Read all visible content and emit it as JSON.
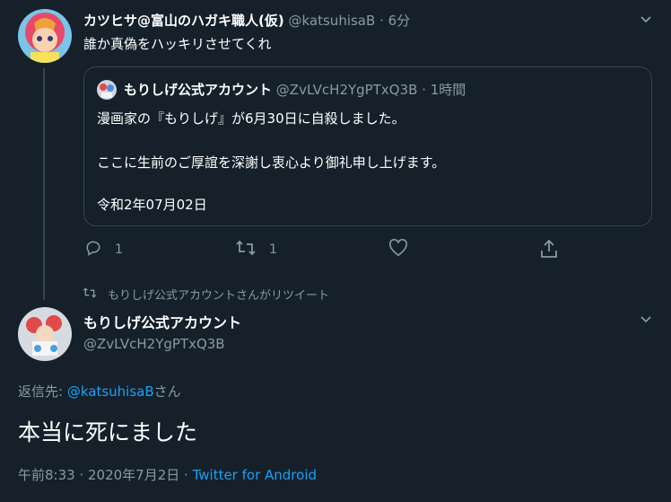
{
  "tweet1": {
    "display_name": "カツヒサ@富山のハガキ職人(仮)",
    "handle": "@katsuhisaB",
    "time": "· 6分",
    "text": "誰か真偽をハッキリさせてくれ",
    "quote": {
      "display_name": "もりしげ公式アカウント",
      "handle": "@ZvLVcH2YgPTxQ3B",
      "time": "· 1時間",
      "line1": "漫画家の『もりしげ』が6月30日に自殺しました。",
      "line2": "ここに生前のご厚誼を深謝し衷心より御礼申し上げます。",
      "line3": "令和2年07月02日"
    },
    "actions": {
      "reply_count": "1",
      "retweet_count": "1"
    }
  },
  "retweet_notice": "もりしげ公式アカウントさんがリツイート",
  "tweet2": {
    "display_name": "もりしげ公式アカウント",
    "handle": "@ZvLVcH2YgPTxQ3B",
    "reply_to_label": "返信先:",
    "reply_to_handle": "@katsuhisaB",
    "reply_to_suffix": "さん",
    "text": "本当に死にました",
    "timestamp": "午前8:33 · 2020年7月2日 ·",
    "source": "Twitter for Android"
  },
  "colors": {
    "background": "#15202b",
    "border": "#38444d",
    "muted": "#8899a6",
    "accent": "#1da1f2"
  },
  "icons": [
    "chevron-down-icon",
    "reply-icon",
    "retweet-icon",
    "like-icon",
    "share-icon"
  ]
}
